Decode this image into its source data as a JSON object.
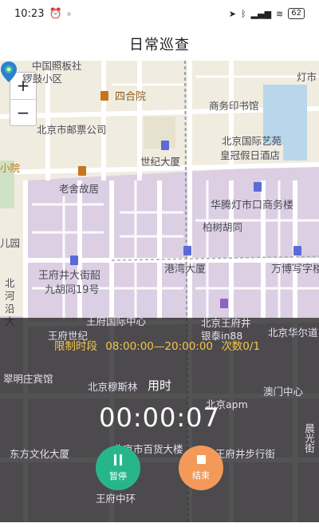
{
  "status_bar": {
    "time": "10:23",
    "battery": "62"
  },
  "header": {
    "title": "日常巡查"
  },
  "map": {
    "zoom_in": "+",
    "zoom_out": "−",
    "labels": {
      "l1": "中国照板社",
      "l2": "锣鼓小区",
      "l3": "四合院",
      "l4": "商务印书馆",
      "l5": "灯市",
      "l6": "北京市邮票公司",
      "l7": "北京国际艺苑",
      "l8": "皇冠假日酒店",
      "l9": "世纪大厦",
      "l10": "小院",
      "l11": "老舍故居",
      "l12": "华腾灯市口商务楼",
      "l13": "柏树胡同",
      "l14": "儿园",
      "l15": "港湾大厦",
      "l16": "万博写字楼",
      "l17": "王府井大街韶",
      "l18": "九胡同19号",
      "l19": "北",
      "l20": "河",
      "l21": "沿",
      "l22": "大",
      "l23": "王府国际中心",
      "l24": "北京王府井",
      "l25": "银泰in88",
      "l26": "王府世纪",
      "l27": "北京华尔道",
      "l28": "翠明庄宾馆",
      "l29": "北京穆斯林",
      "l30": "澳门中心",
      "l31": "北京apm",
      "l32": "东方文化大厦",
      "l33": "北京市百货大楼",
      "l34": "王府井步行街",
      "l35": "王府中环",
      "l36": "晨光街"
    }
  },
  "patrol": {
    "limit_label": "限制时段",
    "limit_range": "08:00:00—20:00:00",
    "count": "次数0/1",
    "elapsed_label": "用时",
    "elapsed": "00:00:07",
    "pause_label": "暂停",
    "end_label": "结束"
  },
  "colors": {
    "pause": "#27b68a",
    "end": "#f39a5a",
    "limit_text": "#f5c54a",
    "map_district": "#dccfe3"
  }
}
